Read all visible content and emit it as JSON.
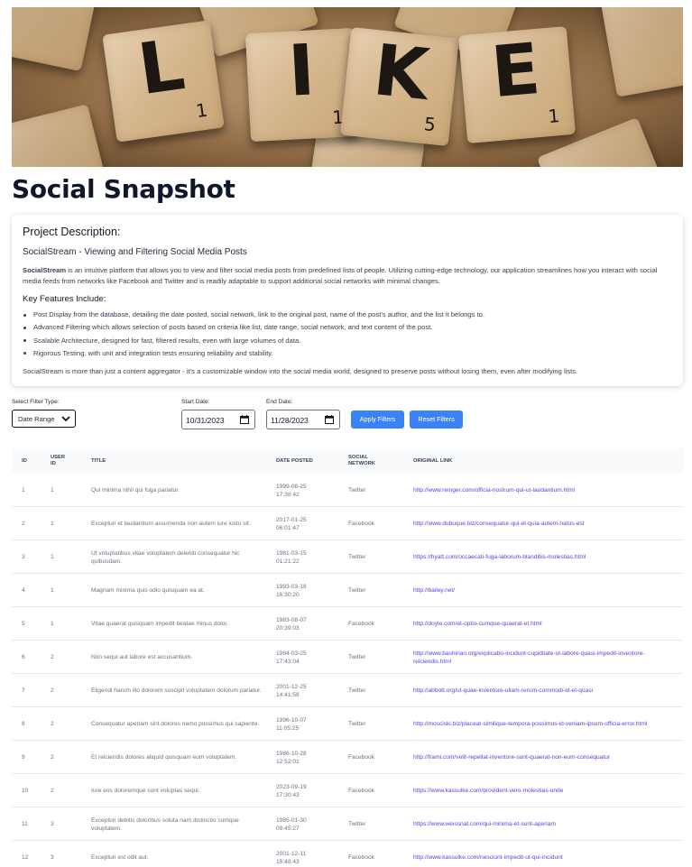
{
  "hero": {
    "letters": [
      "L",
      "I",
      "K",
      "E"
    ],
    "scores": [
      "1",
      "1",
      "5",
      "1"
    ]
  },
  "page_title": "Social Snapshot",
  "description": {
    "heading": "Project Description:",
    "subtitle": "SocialStream - Viewing and Filtering Social Media Posts",
    "intro_bold": "SocialStream",
    "intro_rest": " is an intuitive platform that allows you to view and filter social media posts from predefined lists of people. Utilizing cutting-edge technology, our application streamlines how you interact with social media feeds from networks like Facebook and Twitter and is readily adaptable to support additional social networks with minimal changes.",
    "features_heading": "Key Features Include:",
    "features": [
      "Post Display from the database, detailing the date posted, social network, link to the original post, name of the post's author, and the list it belongs to.",
      "Advanced Filtering which allows selection of posts based on criteria like list, date range, social network, and text content of the post.",
      "Scalable Architecture, designed for fast, filtered results, even with large volumes of data.",
      "Rigorous Testing, with unit and integration tests ensuring reliability and stability."
    ],
    "closing": "SocialStream is more than just a content aggregator - it's a customizable window into the social media world, designed to preserve posts without losing them, even after modifying lists."
  },
  "filters": {
    "type_label": "Select Filter Type:",
    "type_value": "Date Range",
    "start_label": "Start Date:",
    "start_value": "10/31/2023",
    "end_label": "End Date:",
    "end_value": "11/28/2023",
    "apply_label": "Apply Filters",
    "reset_label": "Reset Filters"
  },
  "table": {
    "columns": [
      "ID",
      "USER ID",
      "TITLE",
      "DATE POSTED",
      "SOCIAL NETWORK",
      "ORIGINAL LINK"
    ],
    "rows": [
      {
        "id": "1",
        "user_id": "1",
        "title": "Qui minima nihil qui fuga pariatur.",
        "date": "1999-08-25 17:38:42",
        "network": "Twitter",
        "link": "http://www.reinger.com/officia-nostrum-qui-ut-laudantium.html"
      },
      {
        "id": "2",
        "user_id": "1",
        "title": "Excepturi et laudantium assumenda non autem iure iusto sit.",
        "date": "2017-01-25 06:01:47",
        "network": "Facebook",
        "link": "http://www.dubuque.biz/consequatur-qui-et-quia-autem-natus-est"
      },
      {
        "id": "3",
        "user_id": "1",
        "title": "Ut voluptatibus vitae voluptatem deleniti consequatur hic quibusdam.",
        "date": "1981-03-15 01:21:22",
        "network": "Twitter",
        "link": "https://hyatt.com/occaecati-fuga-laborum-blanditiis-molestias.html"
      },
      {
        "id": "4",
        "user_id": "1",
        "title": "Magnam minima quis odio quisquam ea at.",
        "date": "1993-03-18 16:30:20",
        "network": "Twitter",
        "link": "http://bailey.net/"
      },
      {
        "id": "5",
        "user_id": "1",
        "title": "Vitae quaerat quisquam impedit beatae minus dolor.",
        "date": "1983-08-07 20:39:03",
        "network": "Facebook",
        "link": "http://doyle.com/et-optio-cumque-quaerat-et.html"
      },
      {
        "id": "6",
        "user_id": "2",
        "title": "Non sequi aut labore est accusantium.",
        "date": "1984-03-25 17:43:04",
        "network": "Twitter",
        "link": "http://www.bashirian.org/explicabo-incidunt-cupiditate-ut-labore-quasi-impedit-inventore-reiciendis.html"
      },
      {
        "id": "7",
        "user_id": "2",
        "title": "Eligendi harum illo dolorem suscipit voluptatem dolorum pariatur.",
        "date": "2001-12-25 14:41:58",
        "network": "Twitter",
        "link": "http://abbott.org/ut-quae-inventore-ullam-rerum-commodi-id-et-quasi"
      },
      {
        "id": "8",
        "user_id": "2",
        "title": "Consequatur aperiam sint dolores nemo possimus qui sapiente.",
        "date": "1996-10-07 11:05:25",
        "network": "Twitter",
        "link": "http://mosciski.biz/placeat-similique-tempora-possimus-id-veniam-ipsum-officia-error.html"
      },
      {
        "id": "9",
        "user_id": "2",
        "title": "Et reiciendis dolores aliquid quisquam eum voluptatem.",
        "date": "1986-10-28 12:52:01",
        "network": "Facebook",
        "link": "http://frami.com/velit-repellat-inventore-sunt-quaerat-non-eum-consequatur"
      },
      {
        "id": "10",
        "user_id": "2",
        "title": "Iure eos doloremque sunt voluptas sequi.",
        "date": "2023-09-19 17:30:43",
        "network": "Facebook",
        "link": "https://www.kassulke.com/provident-vero-molestias-unde"
      },
      {
        "id": "11",
        "user_id": "3",
        "title": "Excepturi debitis doloribus soluta nam distinctio cumque voluptatem.",
        "date": "1985-01-30 09:45:27",
        "network": "Twitter",
        "link": "https://www.weissnat.com/qui-minima-et-sunt-aperiam"
      },
      {
        "id": "12",
        "user_id": "3",
        "title": "Excepturi est odit aut.",
        "date": "2001-12-11 15:48:43",
        "network": "Facebook",
        "link": "http://www.kassulke.com/nesciunt-impedit-ut-qui-incidunt"
      }
    ]
  }
}
